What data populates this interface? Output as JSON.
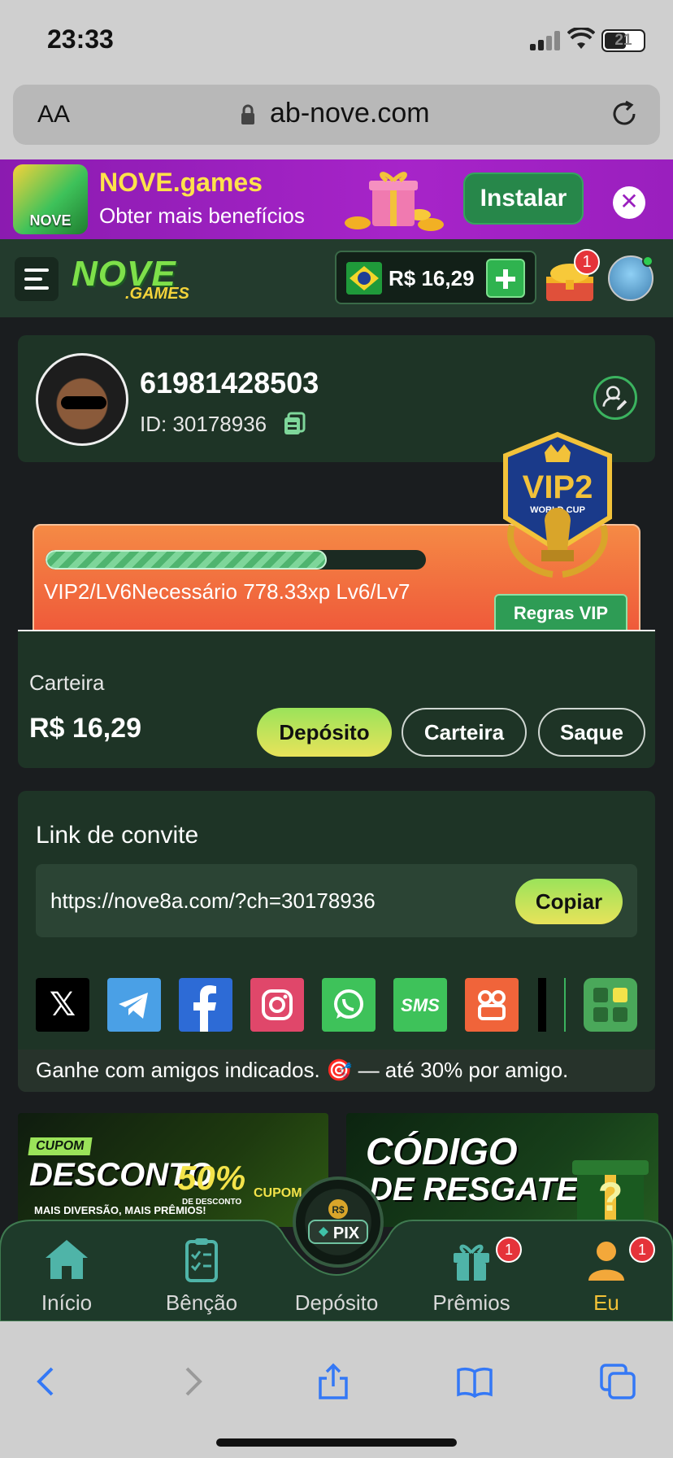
{
  "status_bar": {
    "time": "23:33",
    "battery": "21"
  },
  "browser": {
    "aa_label": "AA",
    "url": "ab-nove.com"
  },
  "install_banner": {
    "title": "NOVE.games",
    "subtitle": "Obter mais benefícios",
    "install_label": "Instalar",
    "logo_text": "NOVE"
  },
  "header": {
    "logo_main": "NOVE",
    "logo_sub": ".GAMES",
    "balance": "R$ 16,29",
    "treasure_badge": "1"
  },
  "profile": {
    "username": "61981428503",
    "user_id": "ID: 30178936"
  },
  "vip": {
    "badge_title": "VIP2",
    "badge_sub": "WORLD CUP",
    "progress": 0.74,
    "level_text": "VIP2/LV6Necessário 778.33xp Lv6/Lv7",
    "rules_label": "Regras VIP"
  },
  "wallet": {
    "label": "Carteira",
    "amount": "R$ 16,29",
    "deposit_label": "Depósito",
    "wallet_label": "Carteira",
    "withdraw_label": "Saque"
  },
  "invite": {
    "title": "Link de convite",
    "link": "https://nove8a.com/?ch=30178936",
    "copy_label": "Copiar",
    "footer_text": "Ganhe com amigos indicados. 🎯 — até 30% por amigo.",
    "share": [
      {
        "name": "x-icon",
        "glyph": "𝕏",
        "color": "#000000"
      },
      {
        "name": "telegram-icon",
        "glyph": "",
        "color": "#4aa0e6"
      },
      {
        "name": "facebook-icon",
        "glyph": "f",
        "color": "#2d6bd6"
      },
      {
        "name": "instagram-icon",
        "glyph": "",
        "color": "#e0476a"
      },
      {
        "name": "whatsapp-icon",
        "glyph": "",
        "color": "#3ec25a"
      },
      {
        "name": "sms-icon",
        "glyph": "SMS",
        "color": "#3ec25a"
      },
      {
        "name": "kwai-icon",
        "glyph": "",
        "color": "#f0643a"
      }
    ]
  },
  "promos": {
    "coupon_tag": "CUPOM",
    "coupon_title": "DESCONTO",
    "coupon_sub": "MAIS DIVERSÃO, MAIS PRÊMIOS!",
    "coupon_pct": "50%",
    "coupon_pct_sub": "DE DESCONTO",
    "coupon_cupom": "CUPOM",
    "code_line1": "CÓDIGO",
    "code_line2": "DE RESGATE"
  },
  "bottom_nav": {
    "items": [
      {
        "label": "Início"
      },
      {
        "label": "Bênção"
      },
      {
        "label": "Depósito"
      },
      {
        "label": "Prêmios",
        "badge": "1"
      },
      {
        "label": "Eu",
        "badge": "1"
      }
    ],
    "pix_label": "PIX"
  },
  "colors": {
    "accent": "#9be35a",
    "active_tab": "#f3c237",
    "badge": "#e5333a"
  }
}
